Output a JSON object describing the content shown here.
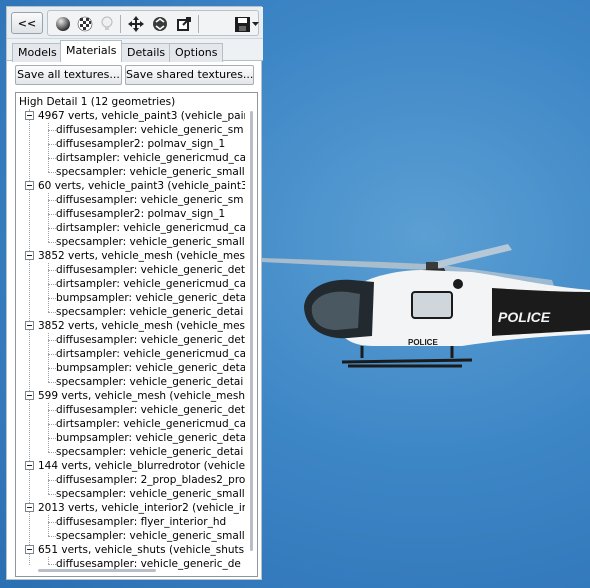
{
  "toolbar": {
    "collapse_label": "<<",
    "icons": [
      "sphere-icon",
      "checker-icon",
      "lightbulb-icon",
      "move-arrows-icon",
      "recycle-icon",
      "export-icon",
      "save-icon",
      "dropdown-arrow-icon"
    ]
  },
  "tabs": [
    {
      "label": "Models",
      "active": false
    },
    {
      "label": "Materials",
      "active": true
    },
    {
      "label": "Details",
      "active": false
    },
    {
      "label": "Options",
      "active": false
    }
  ],
  "actions": {
    "save_all": "Save all textures...",
    "save_shared": "Save shared textures..."
  },
  "tree": {
    "root": "High Detail 1 (12 geometries)",
    "geometries": [
      {
        "label": "4967 verts, vehicle_paint3 (vehicle_pair",
        "textures": [
          "diffusesampler: vehicle_generic_sm",
          "diffusesampler2: polmav_sign_1",
          "dirtsampler: vehicle_genericmud_ca",
          "specsampler: vehicle_generic_small"
        ]
      },
      {
        "label": "60 verts, vehicle_paint3 (vehicle_paint3",
        "textures": [
          "diffusesampler: vehicle_generic_sm",
          "diffusesampler2: polmav_sign_1",
          "dirtsampler: vehicle_genericmud_ca",
          "specsampler: vehicle_generic_small"
        ]
      },
      {
        "label": "3852 verts, vehicle_mesh (vehicle_mesh",
        "textures": [
          "diffusesampler: vehicle_generic_det",
          "dirtsampler: vehicle_genericmud_ca",
          "bumpsampler: vehicle_generic_deta",
          "specsampler: vehicle_generic_detai"
        ]
      },
      {
        "label": "3852 verts, vehicle_mesh (vehicle_mesh",
        "textures": [
          "diffusesampler: vehicle_generic_det",
          "dirtsampler: vehicle_genericmud_ca",
          "bumpsampler: vehicle_generic_deta",
          "specsampler: vehicle_generic_detai"
        ]
      },
      {
        "label": "599 verts, vehicle_mesh (vehicle_mesh",
        "textures": [
          "diffusesampler: vehicle_generic_det",
          "dirtsampler: vehicle_genericmud_ca",
          "bumpsampler: vehicle_generic_deta",
          "specsampler: vehicle_generic_detai"
        ]
      },
      {
        "label": "144 verts, vehicle_blurredrotor (vehicle",
        "textures": [
          "diffusesampler: 2_prop_blades2_pro",
          "specsampler: vehicle_generic_small"
        ]
      },
      {
        "label": "2013 verts, vehicle_interior2 (vehicle_ir",
        "textures": [
          "diffusesampler: flyer_interior_hd",
          "specsampler: vehicle_generic_small"
        ]
      },
      {
        "label": "651 verts, vehicle_shuts (vehicle_shuts",
        "textures": [
          "diffusesampler: vehicle_generic_de"
        ]
      }
    ]
  },
  "viewport": {
    "helicopter_text_side": "POLICE",
    "helicopter_text_bottom": "POLICE",
    "background_color": "#3d86c6"
  }
}
